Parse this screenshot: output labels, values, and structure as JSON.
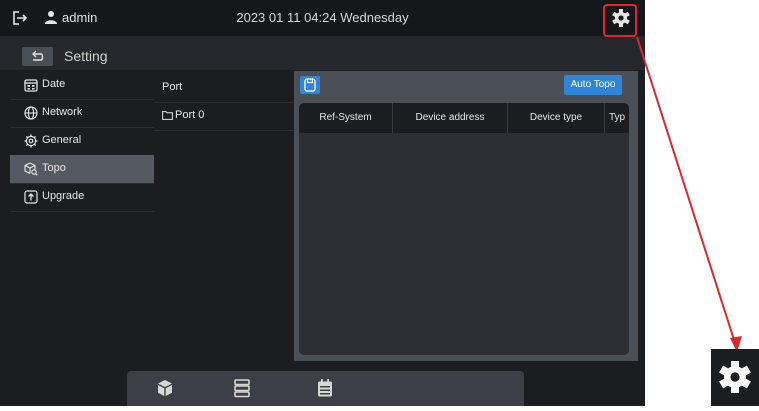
{
  "topbar": {
    "username": "admin",
    "datetime": "2023 01 11 04:24 Wednesday",
    "icons": [
      "exit-icon",
      "user-icon",
      "gear-icon"
    ]
  },
  "header": {
    "title": "Setting"
  },
  "sidebar": {
    "items": [
      {
        "label": "Date",
        "icon": "calendar-icon"
      },
      {
        "label": "Network",
        "icon": "globe-icon"
      },
      {
        "label": "General",
        "icon": "gear-outline-icon"
      },
      {
        "label": "Topo",
        "icon": "cube-search-icon",
        "active": true
      },
      {
        "label": "Upgrade",
        "icon": "upload-icon"
      }
    ]
  },
  "ports": {
    "header": "Port",
    "items": [
      {
        "label": "Port 0"
      }
    ]
  },
  "panel": {
    "auto_topo_label": "Auto Topo",
    "columns": [
      "Ref-System",
      "Device address",
      "Device type",
      "Typ"
    ]
  },
  "colors": {
    "accent": "#2f86d8",
    "annotation": "#e0262c",
    "background": "#1b1d21"
  }
}
